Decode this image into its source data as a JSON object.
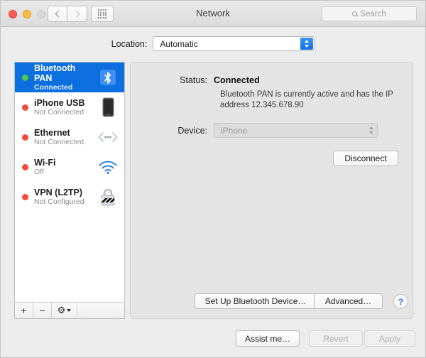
{
  "window": {
    "title": "Network",
    "traffic_lights": [
      "close",
      "minimize",
      "zoom-disabled"
    ]
  },
  "toolbar": {
    "back_icon": "chevron-left-icon",
    "forward_icon": "chevron-right-icon",
    "show_all_icon": "grid-icon",
    "search_placeholder": "Search",
    "search_icon": "search-icon"
  },
  "location": {
    "label": "Location:",
    "value": "Automatic"
  },
  "sidebar": {
    "services": [
      {
        "name": "Bluetooth PAN",
        "state": "Connected",
        "status_color": "#4fc84f",
        "icon": "bluetooth-icon",
        "selected": true
      },
      {
        "name": "iPhone USB",
        "state": "Not Connected",
        "status_color": "#f24b3f",
        "icon": "iphone-icon",
        "selected": false
      },
      {
        "name": "Ethernet",
        "state": "Not Connected",
        "status_color": "#f24b3f",
        "icon": "ethernet-icon",
        "selected": false
      },
      {
        "name": "Wi-Fi",
        "state": "Off",
        "status_color": "#f24b3f",
        "icon": "wifi-icon",
        "selected": false
      },
      {
        "name": "VPN (L2TP)",
        "state": "Not Configured",
        "status_color": "#f24b3f",
        "icon": "vpn-lock-icon",
        "selected": false
      }
    ],
    "footer": {
      "add_label": "+",
      "remove_label": "−",
      "gear_icon": "gear-icon",
      "gear_chevron_icon": "chevron-down-icon"
    }
  },
  "detail": {
    "status_label": "Status:",
    "status_value": "Connected",
    "status_description": "Bluetooth PAN is currently active and has the IP address 12.345.678.90",
    "device_label": "Device:",
    "device_value": "iPhone",
    "disconnect_label": "Disconnect",
    "setup_label": "Set Up Bluetooth Device…",
    "advanced_label": "Advanced…",
    "help_label": "?"
  },
  "bottom": {
    "assist_label": "Assist me…",
    "revert_label": "Revert",
    "apply_label": "Apply"
  },
  "colors": {
    "selection_blue": "#0b6fe0",
    "accent_blue": "#1f7df0",
    "connected_green": "#4fc84f",
    "disconnected_red": "#f24b3f"
  }
}
